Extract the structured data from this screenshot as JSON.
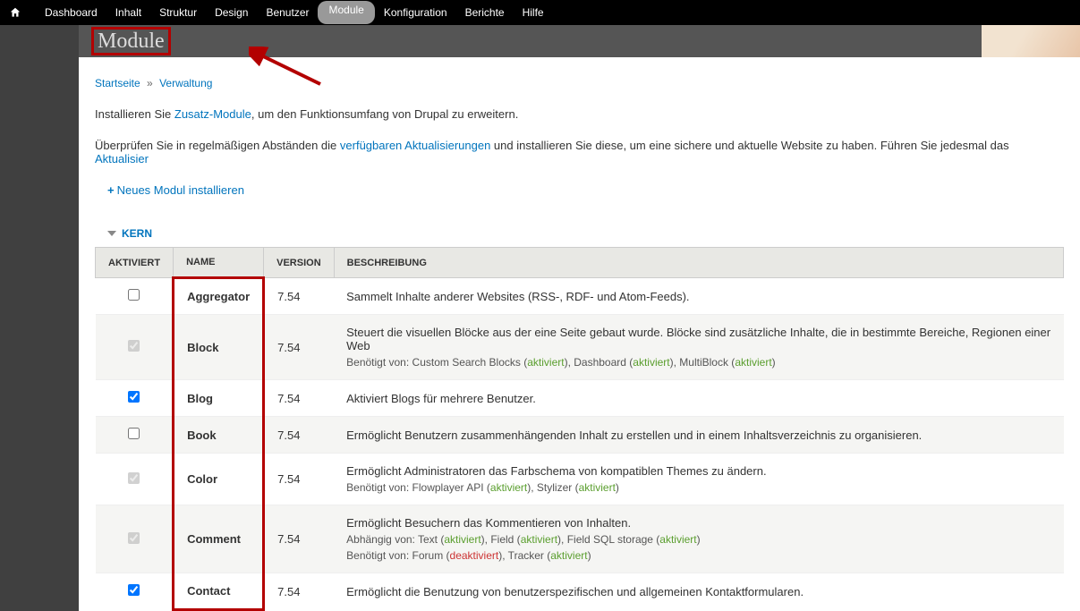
{
  "admin_menu": {
    "items": [
      "Dashboard",
      "Inhalt",
      "Struktur",
      "Design",
      "Benutzer",
      "Module",
      "Konfiguration",
      "Berichte",
      "Hilfe"
    ],
    "active_index": 5
  },
  "page_title": "Module",
  "breadcrumb": {
    "home": "Startseite",
    "admin": "Verwaltung"
  },
  "intro": {
    "line1a": "Installieren Sie ",
    "link1": "Zusatz-Module",
    "line1b": ", um den Funktionsumfang von Drupal zu erweitern.",
    "line2a": "Überprüfen Sie in regelmäßigen Abständen die ",
    "link2": "verfügbaren Aktualisierungen",
    "line2b": " und installieren Sie diese, um eine sichere und aktuelle Website zu haben. Führen Sie jedesmal das ",
    "link3": "Aktualisier"
  },
  "install_new": "Neues Modul installieren",
  "section_title": "KERN",
  "table": {
    "headers": {
      "activated": "Aktiviert",
      "name": "Name",
      "version": "Version",
      "description": "Beschreibung"
    },
    "rows": [
      {
        "checked": false,
        "disabled": false,
        "name": "Aggregator",
        "version": "7.54",
        "description": "Sammelt Inhalte anderer Websites (RSS-, RDF- und Atom-Feeds).",
        "deps": []
      },
      {
        "checked": true,
        "disabled": true,
        "name": "Block",
        "version": "7.54",
        "description": "Steuert die visuellen Blöcke aus der eine Seite gebaut wurde. Blöcke sind zusätzliche Inhalte, die in bestimmte Bereiche, Regionen einer Web",
        "deps": [
          {
            "label": "Benötigt von:",
            "items": [
              {
                "t": "Custom Search Blocks (",
                "s": "aktiviert",
                "a": true,
                "e": "), "
              },
              {
                "t": "Dashboard (",
                "s": "aktiviert",
                "a": true,
                "e": "), "
              },
              {
                "t": "MultiBlock (",
                "s": "aktiviert",
                "a": true,
                "e": ")"
              }
            ]
          }
        ]
      },
      {
        "checked": true,
        "disabled": false,
        "name": "Blog",
        "version": "7.54",
        "description": "Aktiviert Blogs für mehrere Benutzer.",
        "deps": []
      },
      {
        "checked": false,
        "disabled": false,
        "name": "Book",
        "version": "7.54",
        "description": "Ermöglicht Benutzern zusammenhängenden Inhalt zu erstellen und in einem Inhaltsverzeichnis zu organisieren.",
        "deps": []
      },
      {
        "checked": true,
        "disabled": true,
        "name": "Color",
        "version": "7.54",
        "description": "Ermöglicht Administratoren das Farbschema von kompatiblen Themes zu ändern.",
        "deps": [
          {
            "label": "Benötigt von:",
            "items": [
              {
                "t": "Flowplayer API (",
                "s": "aktiviert",
                "a": true,
                "e": "), "
              },
              {
                "t": "Stylizer (",
                "s": "aktiviert",
                "a": true,
                "e": ")"
              }
            ]
          }
        ]
      },
      {
        "checked": true,
        "disabled": true,
        "name": "Comment",
        "version": "7.54",
        "description": "Ermöglicht Besuchern das Kommentieren von Inhalten.",
        "deps": [
          {
            "label": "Abhängig von:",
            "items": [
              {
                "t": "Text (",
                "s": "aktiviert",
                "a": true,
                "e": "), "
              },
              {
                "t": "Field (",
                "s": "aktiviert",
                "a": true,
                "e": "), "
              },
              {
                "t": "Field SQL storage (",
                "s": "aktiviert",
                "a": true,
                "e": ")"
              }
            ]
          },
          {
            "label": "Benötigt von:",
            "items": [
              {
                "t": "Forum (",
                "s": "deaktiviert",
                "a": false,
                "e": "), "
              },
              {
                "t": "Tracker (",
                "s": "aktiviert",
                "a": true,
                "e": ")"
              }
            ]
          }
        ]
      },
      {
        "checked": true,
        "disabled": false,
        "name": "Contact",
        "version": "7.54",
        "description": "Ermöglicht die Benutzung von benutzerspezifischen und allgemeinen Kontaktformularen.",
        "deps": []
      }
    ]
  }
}
